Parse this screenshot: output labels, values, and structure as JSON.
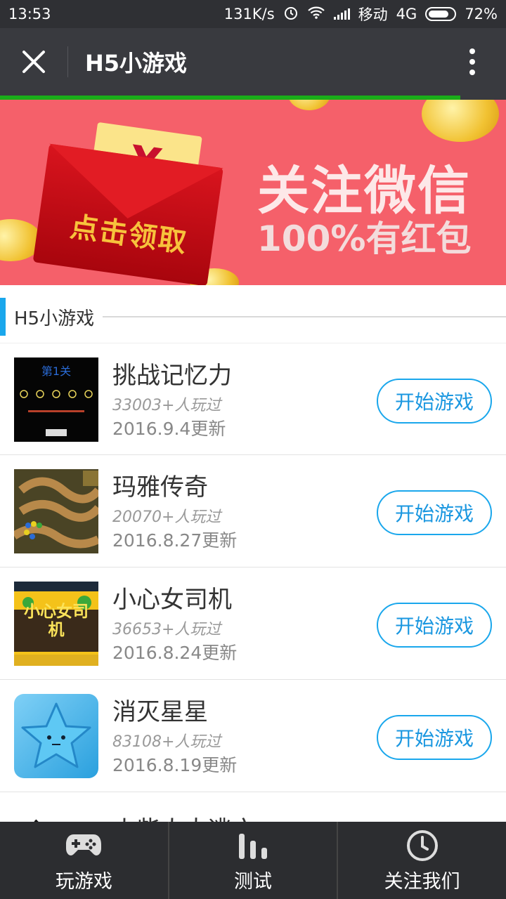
{
  "status_bar": {
    "time": "13:53",
    "network_speed": "131K/s",
    "carrier": "移动",
    "network_type": "4G",
    "battery": "72%"
  },
  "titlebar": {
    "title": "H5小游戏"
  },
  "load_progress": 0.91,
  "banner": {
    "envelope_symbol": "¥",
    "envelope_text": "点击领取",
    "headline": "关注微信",
    "subline": "100%有红包"
  },
  "section": {
    "title": "H5小游戏"
  },
  "games": [
    {
      "name": "挑战记忆力",
      "plays": "33003+人玩过",
      "updated": "2016.9.4更新",
      "button": "开始游戏",
      "thumb_text": "第1关"
    },
    {
      "name": "玛雅传奇",
      "plays": "20070+人玩过",
      "updated": "2016.8.27更新",
      "button": "开始游戏"
    },
    {
      "name": "小心女司机",
      "plays": "36653+人玩过",
      "updated": "2016.8.24更新",
      "button": "开始游戏",
      "thumb_text": "小心女司机"
    },
    {
      "name": "消灭星星",
      "plays": "83108+人玩过",
      "updated": "2016.8.19更新",
      "button": "开始游戏"
    },
    {
      "name": "火柴人大逃亡"
    }
  ],
  "bottom_nav": [
    {
      "label": "玩游戏",
      "icon": "gamepad-icon"
    },
    {
      "label": "测试",
      "icon": "bar-chart-icon"
    },
    {
      "label": "关注我们",
      "icon": "clock-icon"
    }
  ],
  "colors": {
    "accent": "#1aa7ec",
    "progress": "#1aad19",
    "titlebar": "#393a3f",
    "banner": "#f5606a"
  }
}
